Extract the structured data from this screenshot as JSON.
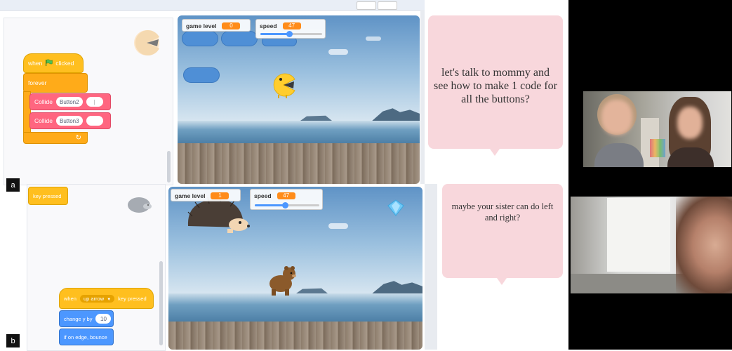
{
  "panel_a": {
    "tag": "a",
    "script": {
      "hat_when": "when",
      "hat_clicked": "clicked",
      "forever": "forever",
      "collide_1": "Collide",
      "collide_1_arg": "Button2",
      "collide_2": "Collide",
      "collide_2_arg": "Button3"
    },
    "hud": {
      "game_level_label": "game level",
      "game_level_value": "0",
      "speed_label": "speed",
      "speed_value": "47",
      "speed_fraction": 0.47
    },
    "bubble_text": "let's talk to mommy and see how to make 1 code for all the buttons?"
  },
  "panel_b": {
    "tag": "b",
    "script": {
      "key_pressed_block": "key pressed",
      "hat_when": "when",
      "hat_key": "up arrow",
      "hat_key_pressed": "key pressed",
      "change_y": "change y by",
      "change_y_value": "10",
      "bounce": "if on edge, bounce"
    },
    "hud": {
      "game_level_label": "game level",
      "game_level_value": "1",
      "speed_label": "speed",
      "speed_value": "47",
      "speed_fraction": 0.47
    },
    "bubble_text": "maybe your sister can do left and right?"
  },
  "colors": {
    "events": "#ffbf1f",
    "control": "#ffab19",
    "custom": "#ff6680",
    "motion": "#4c97ff",
    "monitor": "#ff8c1a",
    "bubble": "#f8d7dc"
  },
  "icons": [
    "green-flag-icon",
    "pacman-sprite-icon",
    "hedgehog-sprite-icon",
    "bear-sprite-icon",
    "diamond-sprite-icon",
    "dropdown-arrow-icon",
    "loop-arrow-icon"
  ]
}
